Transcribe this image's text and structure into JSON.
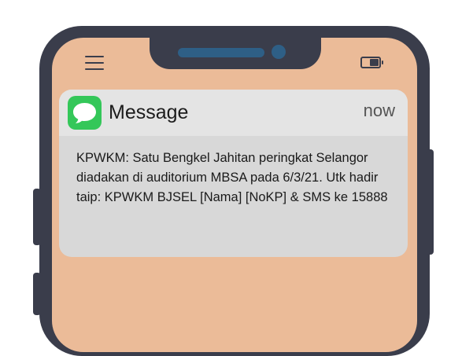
{
  "status_bar": {
    "menu_icon": "hamburger-menu-icon",
    "battery_icon": "battery-icon"
  },
  "notification": {
    "app_icon": "message-bubble-icon",
    "app_name": "Message",
    "time": "now",
    "body": "KPWKM: Satu Bengkel Jahitan peringkat Selangor diadakan di auditorium MBSA pada 6/3/21. Utk hadir taip: KPWKM BJSEL [Nama] [NoKP] & SMS ke 15888"
  },
  "colors": {
    "phone_frame": "#3a3d4b",
    "screen": "#ebbb98",
    "app_icon": "#34c759",
    "camera": "#2e5f86"
  }
}
